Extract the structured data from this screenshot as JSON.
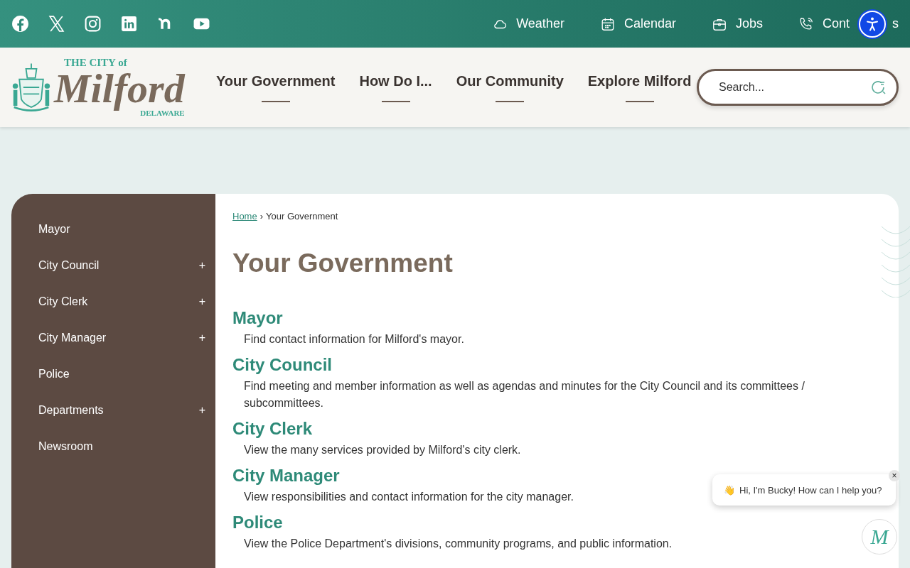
{
  "utility_links": [
    {
      "label": "Weather"
    },
    {
      "label": "Calendar"
    },
    {
      "label": "Jobs"
    },
    {
      "label": "Cont",
      "label_end": "s"
    }
  ],
  "logo": {
    "top": "THE CITY of",
    "name": "Milford",
    "bottom": "DELAWARE"
  },
  "nav": [
    "Your Government",
    "How Do I...",
    "Our Community",
    "Explore Milford"
  ],
  "search": {
    "placeholder": "Search..."
  },
  "sidebar": {
    "items": [
      {
        "label": "Mayor",
        "expandable": false
      },
      {
        "label": "City Council",
        "expandable": true
      },
      {
        "label": "City Clerk",
        "expandable": true
      },
      {
        "label": "City Manager",
        "expandable": true
      },
      {
        "label": "Police",
        "expandable": false
      },
      {
        "label": "Departments",
        "expandable": true
      },
      {
        "label": "Newsroom",
        "expandable": false
      }
    ],
    "expand_symbol": "+"
  },
  "breadcrumb": {
    "home": "Home",
    "separator": "›",
    "current": "Your Government"
  },
  "title": "Your Government",
  "sections": [
    {
      "heading": "Mayor",
      "description": "Find contact information for Milford's mayor."
    },
    {
      "heading": "City Council",
      "description": "Find meeting and member information as well as agendas and minutes for the City Council and its committees / subcommittees."
    },
    {
      "heading": "City Clerk",
      "description": "View the many services provided by Milford's city clerk."
    },
    {
      "heading": "City Manager",
      "description": "View responsibilities and contact information for the city manager."
    },
    {
      "heading": "Police",
      "description": "View the Police Department's divisions, community programs, and public information."
    }
  ],
  "chat": {
    "message": "Hi, I'm Bucky! How can I help you?",
    "emoji": "👋",
    "close": "×",
    "launcher": "M"
  }
}
